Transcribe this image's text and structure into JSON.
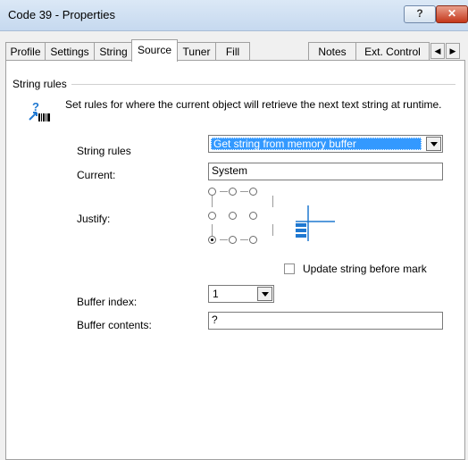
{
  "window": {
    "title": "Code 39 - Properties",
    "help_label": "?",
    "close_label": "✕"
  },
  "tabs": [
    {
      "label": "Profile"
    },
    {
      "label": "Settings"
    },
    {
      "label": "String"
    },
    {
      "label": "Source",
      "active": true
    },
    {
      "label": "Tuner"
    },
    {
      "label": "Fill"
    },
    {
      "label": "Notes"
    },
    {
      "label": "Ext. Control"
    }
  ],
  "tab_scroll": {
    "left": "◀",
    "right": "▶"
  },
  "group": {
    "title": "String rules",
    "description": "Set rules for where the current object will retrieve the next text string at runtime."
  },
  "fields": {
    "string_rules_label": "String rules",
    "string_rules_value": "Get string from memory buffer",
    "current_label": "Current:",
    "current_value": "System",
    "justify_label": "Justify:",
    "justify_selected": "bottom-left",
    "update_checkbox_label": "Update string before mark",
    "update_checkbox_checked": false,
    "buffer_index_label": "Buffer index:",
    "buffer_index_value": "1",
    "buffer_contents_label": "Buffer contents:",
    "buffer_contents_value": "?"
  },
  "icons": {
    "title_help": "help-icon",
    "title_close": "close-icon",
    "rule": "string-rules-barcode-icon",
    "justify": "justify-preview-icon"
  },
  "colors": {
    "selection": "#3399ff",
    "close_button": "#c4371a",
    "icon_blue": "#1f78d1"
  }
}
